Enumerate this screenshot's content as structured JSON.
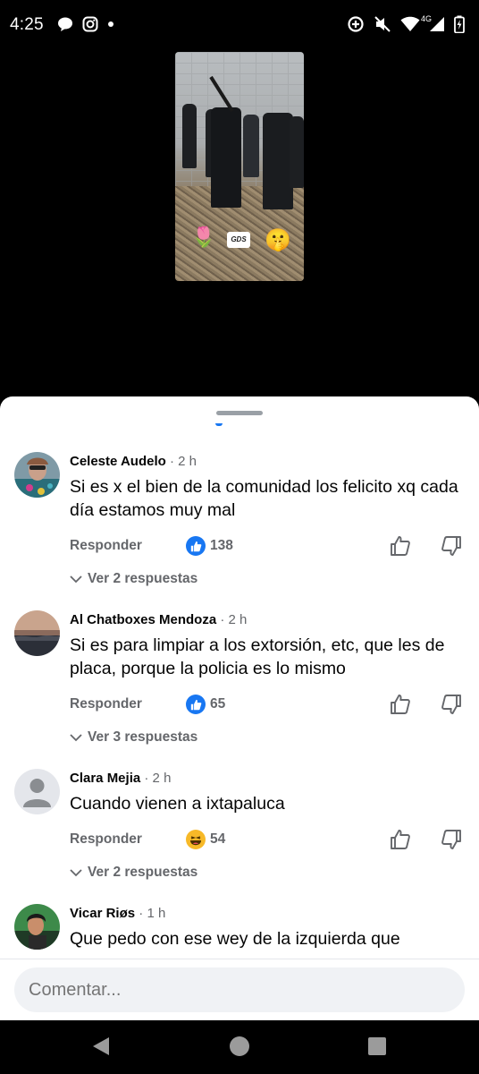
{
  "status_bar": {
    "time": "4:25",
    "network": "4G",
    "icons_left": [
      "chat-bubble-icon",
      "instagram-icon",
      "dot-icon"
    ],
    "icons_right": [
      "data-saver-icon",
      "mute-icon",
      "wifi-icon",
      "signal-icon",
      "battery-icon"
    ]
  },
  "video": {
    "sticker_text": "GDS",
    "stickers": [
      "flower-sticker",
      "gds-sticker",
      "shush-emoji-sticker"
    ]
  },
  "comments": [
    {
      "author": "Celeste Audelo",
      "time": "· 2 h",
      "text": "Si es x el bien de la comunidad los  felicito xq cada día estamos muy mal",
      "reply_label": "Responder",
      "reaction": "like",
      "reaction_count": "138",
      "replies_label": "Ver 2 respuestas"
    },
    {
      "author": "Al Chatboxes Mendoza",
      "time": "· 2 h",
      "text": "Si es para limpiar a los extorsión, etc, que les de placa, porque la policia es lo mismo",
      "reply_label": "Responder",
      "reaction": "like",
      "reaction_count": "65",
      "replies_label": "Ver 3 respuestas"
    },
    {
      "author": "Clara Mejia",
      "time": "· 2 h",
      "text": "Cuando vienen a ixtapaluca",
      "reply_label": "Responder",
      "reaction": "haha",
      "reaction_count": "54",
      "replies_label": "Ver 2 respuestas"
    },
    {
      "author": "Vicar Riøs",
      "time": "· 1 h",
      "text": "Que pedo con ese wey  de la izquierda que"
    }
  ],
  "composer": {
    "placeholder": "Comentar..."
  },
  "nav": {
    "buttons": [
      "back",
      "home",
      "recents"
    ]
  },
  "colors": {
    "accent_blue": "#1877f2",
    "secondary_text": "#65676b",
    "input_bg": "#f0f2f5"
  }
}
